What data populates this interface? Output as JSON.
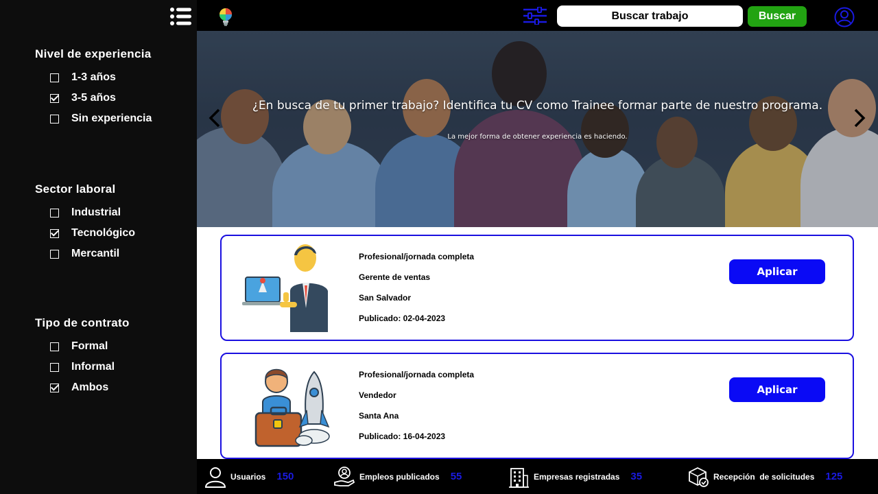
{
  "sidebar": {
    "menu_icon": "list-icon",
    "groups": [
      {
        "title": "Nivel de experiencia",
        "options": [
          {
            "label": "1-3 años",
            "checked": false
          },
          {
            "label": "3-5 años",
            "checked": true
          },
          {
            "label": "Sin experiencia",
            "checked": false
          }
        ]
      },
      {
        "title": "Sector laboral",
        "options": [
          {
            "label": "Industrial",
            "checked": false
          },
          {
            "label": "Tecnológico",
            "checked": true
          },
          {
            "label": "Mercantil",
            "checked": false
          }
        ]
      },
      {
        "title": "Tipo de contrato",
        "options": [
          {
            "label": "Formal",
            "checked": false
          },
          {
            "label": "Informal",
            "checked": false
          },
          {
            "label": "Ambos",
            "checked": true
          }
        ]
      }
    ]
  },
  "topbar": {
    "logo_icon": "lightbulb-logo-icon",
    "filter_icon": "sliders-icon",
    "search_placeholder": "Buscar trabajo",
    "search_button": "Buscar",
    "user_icon": "user-circle-icon"
  },
  "banner": {
    "title": "¿En busca de tu primer trabajo? Identifica tu CV como Trainee formar parte de nuestro programa.",
    "subtitle": "La mejor forma de obtener experiencia es haciendo."
  },
  "jobs": [
    {
      "type": "Profesional/jornada completa",
      "position": "Gerente de ventas",
      "location": "San Salvador",
      "published": "Publicado: 02-04-2023",
      "apply_label": "Aplicar",
      "image_icon": "businessman-laptop-icon"
    },
    {
      "type": "Profesional/jornada completa",
      "position": "Vendedor",
      "location": "Santa Ana",
      "published": "Publicado: 16-04-2023",
      "apply_label": "Aplicar",
      "image_icon": "person-briefcase-rocket-icon"
    }
  ],
  "footer": {
    "stats": [
      {
        "label": "Usuarios",
        "value": "150",
        "icon": "user-icon"
      },
      {
        "label": "Empleos publicados",
        "value": "55",
        "icon": "job-hand-icon"
      },
      {
        "label": "Empresas registradas",
        "value": "35",
        "icon": "building-icon"
      },
      {
        "label": "Recepción  de solicitudes",
        "value": "125",
        "icon": "package-check-icon"
      }
    ]
  },
  "colors": {
    "sidebar_bg": "#0d0d0d",
    "accent_blue": "#0a0af5",
    "search_green": "#22a312",
    "card_border": "#1a0fe0"
  }
}
